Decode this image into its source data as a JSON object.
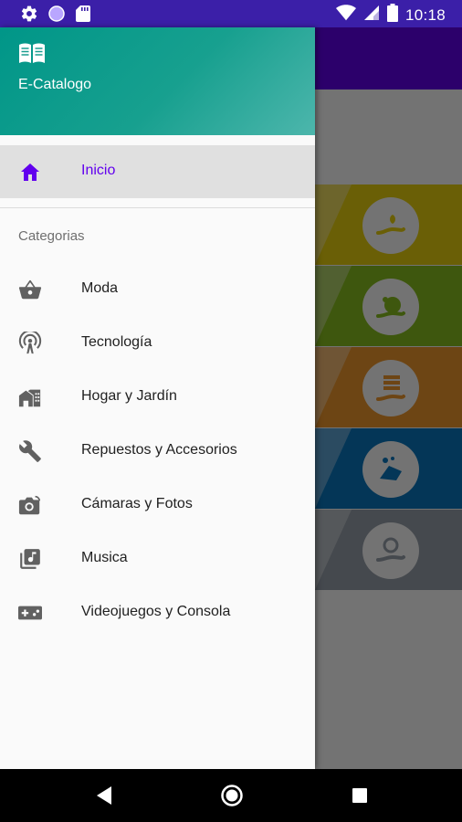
{
  "status_bar": {
    "time": "10:18",
    "left_icons": [
      "gear-icon",
      "circle-icon",
      "sd-card-icon"
    ],
    "right_icons": [
      "wifi-icon",
      "signal-icon",
      "battery-icon"
    ],
    "color": "#3b1fa8"
  },
  "drawer": {
    "header": {
      "title": "E-Catalogo",
      "icon": "book-open-icon"
    },
    "home": {
      "label": "Inicio",
      "icon": "home-icon",
      "active": true
    },
    "section_title": "Categorias",
    "categories": [
      {
        "label": "Moda",
        "icon": "basket-icon"
      },
      {
        "label": "Tecnología",
        "icon": "antenna-icon"
      },
      {
        "label": "Hogar y Jardín",
        "icon": "house-icon"
      },
      {
        "label": "Repuestos y Accesorios",
        "icon": "wrench-icon"
      },
      {
        "label": "Cámaras y Fotos",
        "icon": "camera-icon"
      },
      {
        "label": "Musica",
        "icon": "music-library-icon"
      },
      {
        "label": "Videojuegos y Consola",
        "icon": "gamepad-icon"
      }
    ]
  },
  "background_cards": [
    {
      "color": "#ecd20f",
      "icon": "hand-leaf-icon"
    },
    {
      "color": "#8bc01f",
      "icon": "hand-wash-icon"
    },
    {
      "color": "#f29a2e",
      "icon": "hand-stack-icon"
    },
    {
      "color": "#0a79c2",
      "icon": "hand-soap-icon"
    },
    {
      "color": "#9aa3ad",
      "icon": "hand-search-icon"
    }
  ],
  "nav_bar": {
    "buttons": [
      "back-icon",
      "home-circle-icon",
      "recents-icon"
    ]
  },
  "colors": {
    "accent": "#6200ee",
    "header_gradient_start": "#009688",
    "header_gradient_end": "#4db6ac"
  }
}
